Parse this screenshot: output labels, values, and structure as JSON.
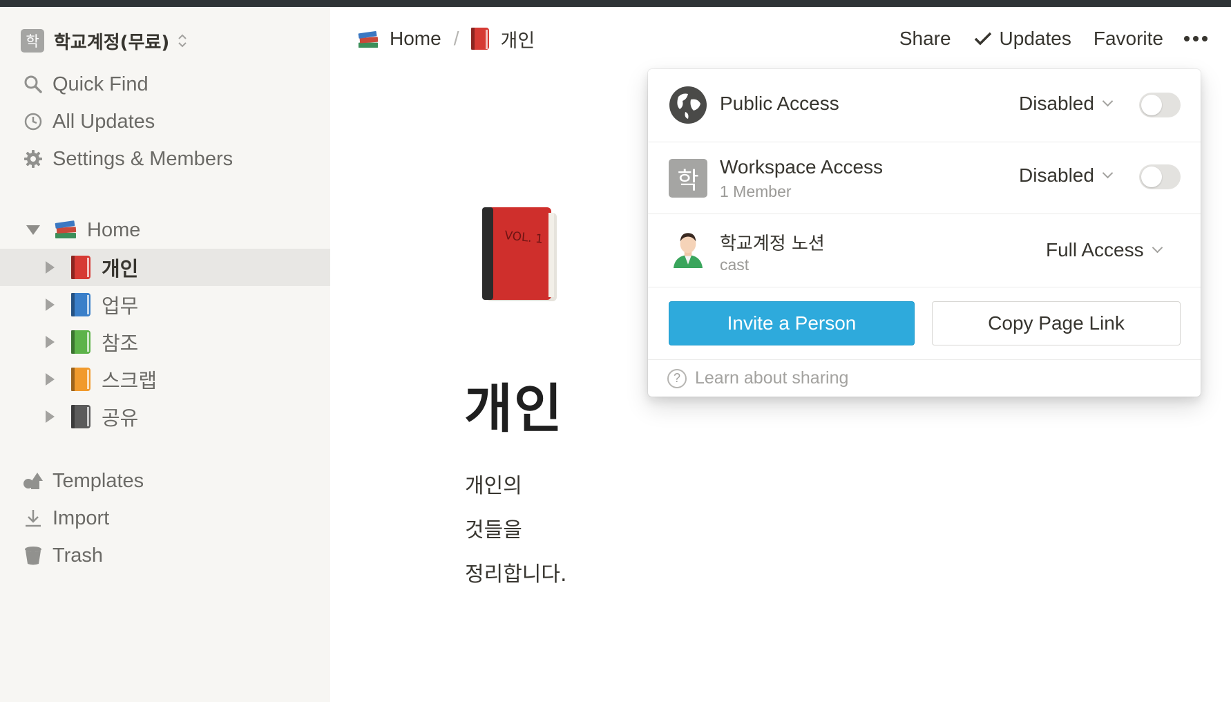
{
  "workspace": {
    "avatar_letter": "학",
    "name": "학교계정(무료)"
  },
  "sidebar": {
    "quick": [
      {
        "label": "Quick Find",
        "icon": "search-icon"
      },
      {
        "label": "All Updates",
        "icon": "clock-icon"
      },
      {
        "label": "Settings & Members",
        "icon": "gear-icon"
      }
    ],
    "home": {
      "label": "Home",
      "icon": "books-icon"
    },
    "pages": [
      {
        "label": "개인",
        "color": "#d63a34",
        "active": true
      },
      {
        "label": "업무",
        "color": "#3a7fc9"
      },
      {
        "label": "참조",
        "color": "#5db34a"
      },
      {
        "label": "스크랩",
        "color": "#f19a2c"
      },
      {
        "label": "공유",
        "color": "#5b5b5b"
      }
    ],
    "bottom": [
      {
        "label": "Templates",
        "icon": "templates-icon"
      },
      {
        "label": "Import",
        "icon": "download-icon"
      },
      {
        "label": "Trash",
        "icon": "trash-icon"
      }
    ]
  },
  "header": {
    "breadcrumb": [
      {
        "label": "Home",
        "icon": "books-icon"
      },
      {
        "label": "개인",
        "icon": "red-book-icon"
      }
    ],
    "separator": "/",
    "share_label": "Share",
    "updates_label": "Updates",
    "favorite_label": "Favorite"
  },
  "page": {
    "title": "개인",
    "paragraphs": [
      "개인의",
      "것들을",
      "정리합니다."
    ],
    "cover_text": "VOL. 1"
  },
  "share_popover": {
    "public": {
      "title": "Public Access",
      "value": "Disabled",
      "enabled": false
    },
    "workspace": {
      "title": "Workspace Access",
      "subtitle": "1 Member",
      "value": "Disabled",
      "enabled": false,
      "avatar_letter": "학"
    },
    "member": {
      "name": "학교계정 노션",
      "subtitle": "cast",
      "value": "Full Access"
    },
    "invite_label": "Invite a Person",
    "copy_link_label": "Copy Page Link",
    "help_label": "Learn about sharing"
  },
  "colors": {
    "accent": "#2eaadc",
    "sidebar_bg": "#f7f6f3",
    "text": "#37352f"
  }
}
